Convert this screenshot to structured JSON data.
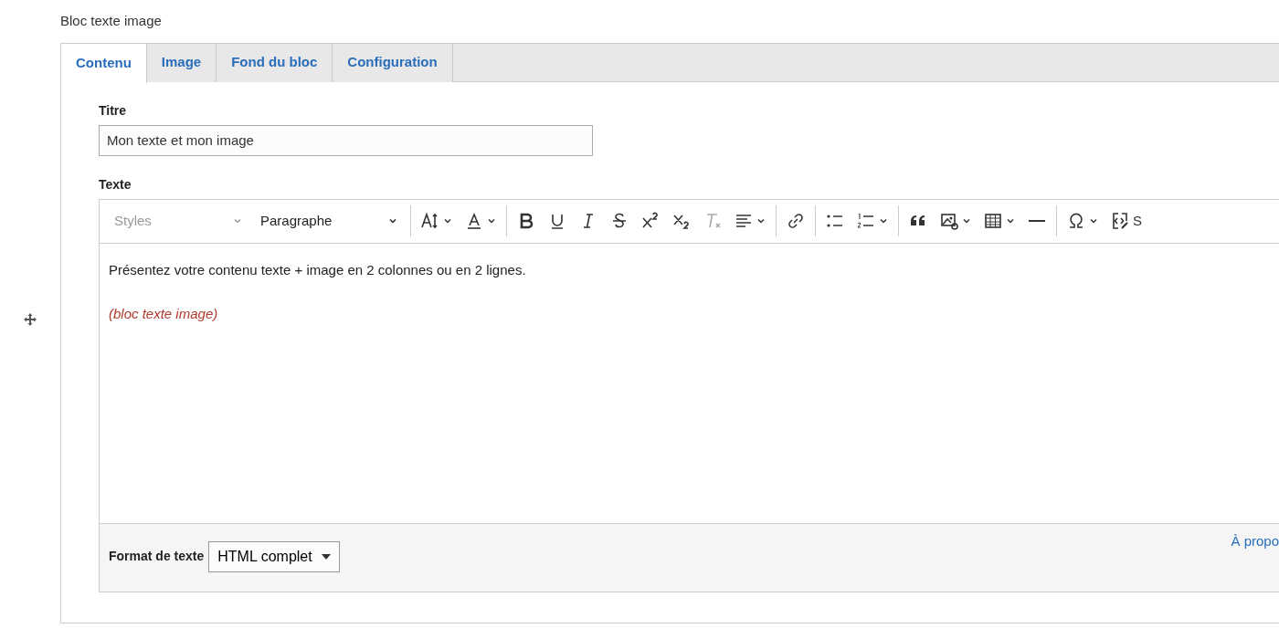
{
  "block_title": "Bloc texte image",
  "tabs": [
    {
      "label": "Contenu",
      "selected": true
    },
    {
      "label": "Image",
      "selected": false
    },
    {
      "label": "Fond du bloc",
      "selected": false
    },
    {
      "label": "Configuration",
      "selected": false
    }
  ],
  "title_field": {
    "label": "Titre",
    "value": "Mon texte et mon image"
  },
  "text_field": {
    "label": "Texte",
    "toolbar": {
      "styles": {
        "placeholder": "Styles",
        "disabled": true
      },
      "heading": {
        "value": "Paragraphe",
        "disabled": false
      },
      "buttons": [
        {
          "caret": true,
          "disabled": false
        },
        {
          "caret": true,
          "disabled": false
        },
        {
          "caret": false,
          "disabled": false
        },
        {
          "caret": false,
          "disabled": false
        },
        {
          "caret": false,
          "disabled": false
        },
        {
          "caret": false,
          "disabled": false
        },
        {
          "caret": false,
          "disabled": false
        },
        {
          "caret": false,
          "disabled": false
        },
        {
          "caret": false,
          "disabled": true
        },
        {
          "caret": true,
          "disabled": false
        },
        {
          "caret": false,
          "disabled": false
        },
        {
          "caret": false,
          "disabled": false
        },
        {
          "caret": true,
          "disabled": false
        },
        {
          "caret": false,
          "disabled": false
        },
        {
          "caret": true,
          "disabled": false
        },
        {
          "caret": true,
          "disabled": false
        },
        {
          "caret": false,
          "disabled": false
        },
        {
          "caret": true,
          "disabled": false
        },
        {
          "caret": false,
          "disabled": false,
          "label": "S"
        }
      ]
    },
    "paragraphs": [
      {
        "text": "Présentez votre contenu texte + image en 2 colonnes ou en 2 lignes.",
        "kind": "normal"
      },
      {
        "text": "(bloc texte image)",
        "kind": "note"
      }
    ],
    "format": {
      "label": "Format de texte",
      "value": "HTML complet"
    },
    "about_link": "À propo"
  }
}
